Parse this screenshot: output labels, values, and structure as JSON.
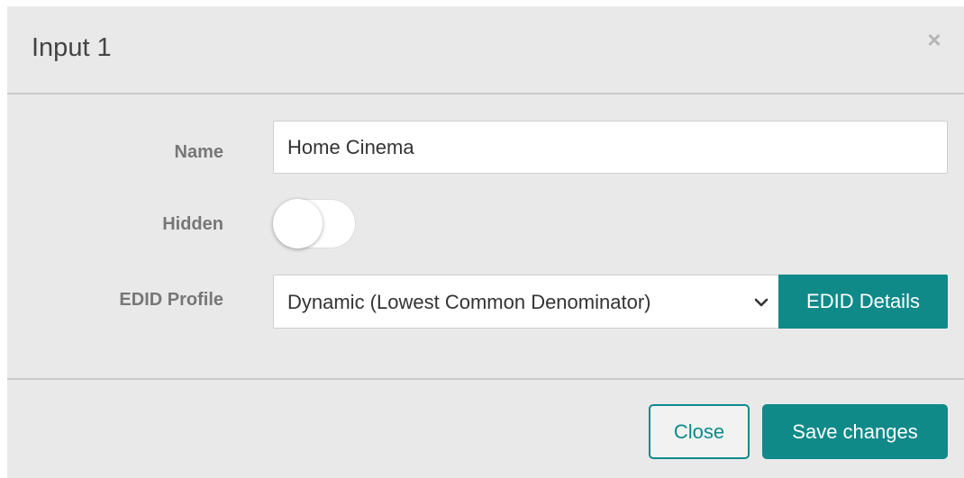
{
  "modal": {
    "title": "Input 1",
    "close_glyph": "×",
    "icons": {
      "close": "close-icon",
      "dropdown": "chevron-down-icon"
    }
  },
  "form": {
    "name": {
      "label": "Name",
      "value": "Home Cinema"
    },
    "hidden": {
      "label": "Hidden",
      "checked": false
    },
    "edid_profile": {
      "label": "EDID Profile",
      "selected": "Dynamic (Lowest Common Denominator)",
      "details_button": "EDID Details"
    }
  },
  "footer": {
    "close_label": "Close",
    "save_label": "Save changes"
  },
  "colors": {
    "accent": "#0f8a89",
    "modal_background": "#e9e9e9",
    "label_text": "#777777"
  }
}
